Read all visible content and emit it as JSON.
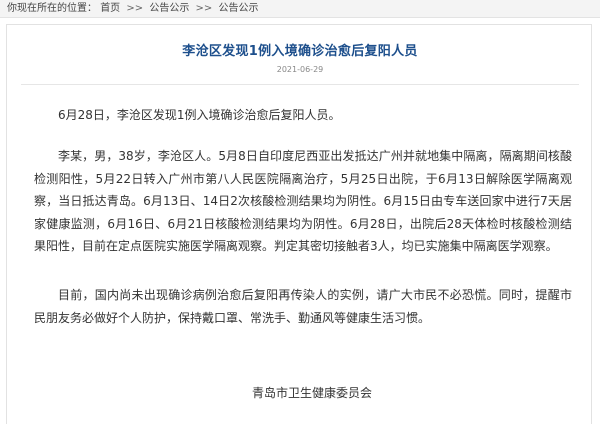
{
  "breadcrumb": {
    "prefix": "你现在所在的位置：",
    "items": [
      "首页",
      "公告公示",
      "公告公示"
    ],
    "separator": ">>"
  },
  "article": {
    "title": "李沧区发现1例入境确诊治愈后复阳人员",
    "date": "2021-06-29",
    "paragraphs": [
      "6月28日，李沧区发现1例入境确诊治愈后复阳人员。",
      "李某，男，38岁，李沧区人。5月8日自印度尼西亚出发抵达广州并就地集中隔离，隔离期间核酸检测阳性，5月22日转入广州市第八人民医院隔离治疗，5月25日出院，于6月13日解除医学隔离观察，当日抵达青岛。6月13日、14日2次核酸检测结果均为阴性。6月15日由专车送回家中进行7天居家健康监测，6月16日、6月21日核酸检测结果均为阴性。6月28日，出院后28天体检时核酸检测结果阳性，目前在定点医院实施医学隔离观察。判定其密切接触者3人，均已实施集中隔离医学观察。",
      "目前，国内尚未出现确诊病例治愈后复阳再传染人的实例，请广大市民不必恐慌。同时，提醒市民朋友务必做好个人防护，保持戴口罩、常洗手、勤通风等健康生活习惯。"
    ],
    "signature": "青岛市卫生健康委员会"
  }
}
